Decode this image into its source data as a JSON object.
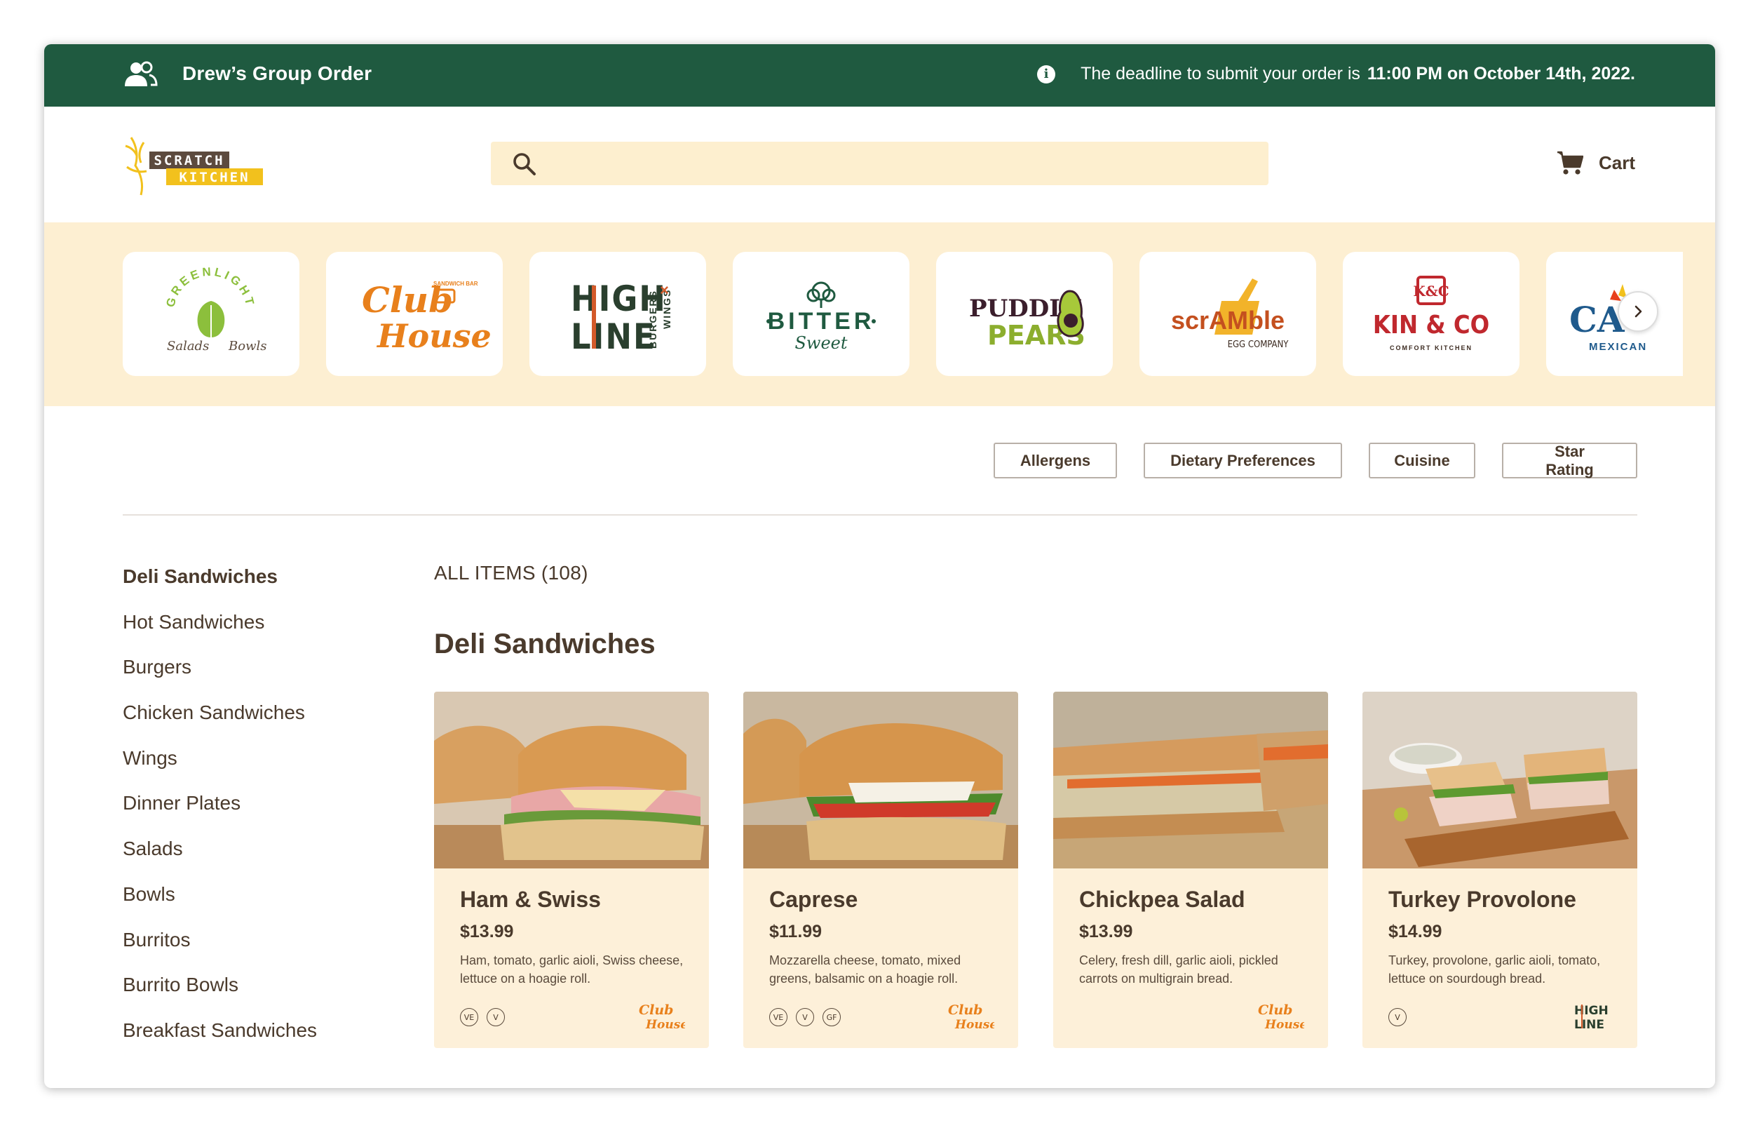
{
  "group_order": {
    "title": "Drew’s Group Order",
    "deadline_prefix": "The deadline to submit your order is ",
    "deadline_value": "11:00 PM on October 14th, 2022."
  },
  "header": {
    "logo_text_top": "SCRATCH",
    "logo_text_bottom": "KITCHEN",
    "search_placeholder": "",
    "cart_label": "Cart"
  },
  "brands": [
    {
      "name": "Greenlight Salads Bowls",
      "line1": "GREENLIGHT",
      "line2": "Salads",
      "line3": "Bowls"
    },
    {
      "name": "Club House",
      "line1": "Club",
      "line2": "House",
      "line3": "SANDWICH BAR"
    },
    {
      "name": "High Line Burgers Wings",
      "line1": "HIGH",
      "line2": "LINE",
      "line3": "BURGERS",
      "line4": "WINGS"
    },
    {
      "name": "Bitter Sweet",
      "line1": "BITTER",
      "line2": "Sweet"
    },
    {
      "name": "Puddin Pears",
      "line1": "PUDDIN",
      "line2": "PEARS"
    },
    {
      "name": "Scramble Egg Company",
      "line1": "scrAMble",
      "line2": "EGG COMPANY"
    },
    {
      "name": "Kin & Co Comfort Kitchen",
      "line1": "KIN & CO",
      "line2": "COMFORT KITCHEN",
      "line3": "K&C"
    },
    {
      "name": "Casa Mexicana",
      "line1": "CA",
      "line2": "MEXICAN"
    }
  ],
  "filters": [
    "Allergens",
    "Dietary Preferences",
    "Cuisine",
    "Star Rating"
  ],
  "categories": [
    "Deli Sandwiches",
    "Hot Sandwiches",
    "Burgers",
    "Chicken Sandwiches",
    "Wings",
    "Dinner Plates",
    "Salads",
    "Bowls",
    "Burritos",
    "Burrito Bowls",
    "Breakfast Sandwiches"
  ],
  "active_category": "Deli Sandwiches",
  "main": {
    "all_items_label": "ALL ITEMS (108)",
    "section_title": "Deli Sandwiches"
  },
  "items": [
    {
      "name": "Ham & Swiss",
      "price": "$13.99",
      "description": "Ham, tomato, garlic aioli, Swiss cheese, lettuce on a hoagie roll.",
      "badges": [
        "VE",
        "V"
      ],
      "brand": "club-house"
    },
    {
      "name": "Caprese",
      "price": "$11.99",
      "description": "Mozzarella cheese, tomato, mixed greens, balsamic on a hoagie roll.",
      "badges": [
        "VE",
        "V",
        "GF"
      ],
      "brand": "club-house"
    },
    {
      "name": "Chickpea Salad",
      "price": "$13.99",
      "description": "Celery, fresh dill, garlic aioli, pickled carrots on multigrain bread.",
      "badges": [],
      "brand": "club-house"
    },
    {
      "name": "Turkey Provolone",
      "price": "$14.99",
      "description": "Turkey, provolone, garlic aioli, tomato, lettuce on sourdough bread.",
      "badges": [
        "V"
      ],
      "brand": "high-line"
    }
  ],
  "colors": {
    "primary_green": "#1f5a40",
    "cream": "#fdefd2",
    "text_brown": "#4a3a2c",
    "club_orange": "#e8801c"
  }
}
